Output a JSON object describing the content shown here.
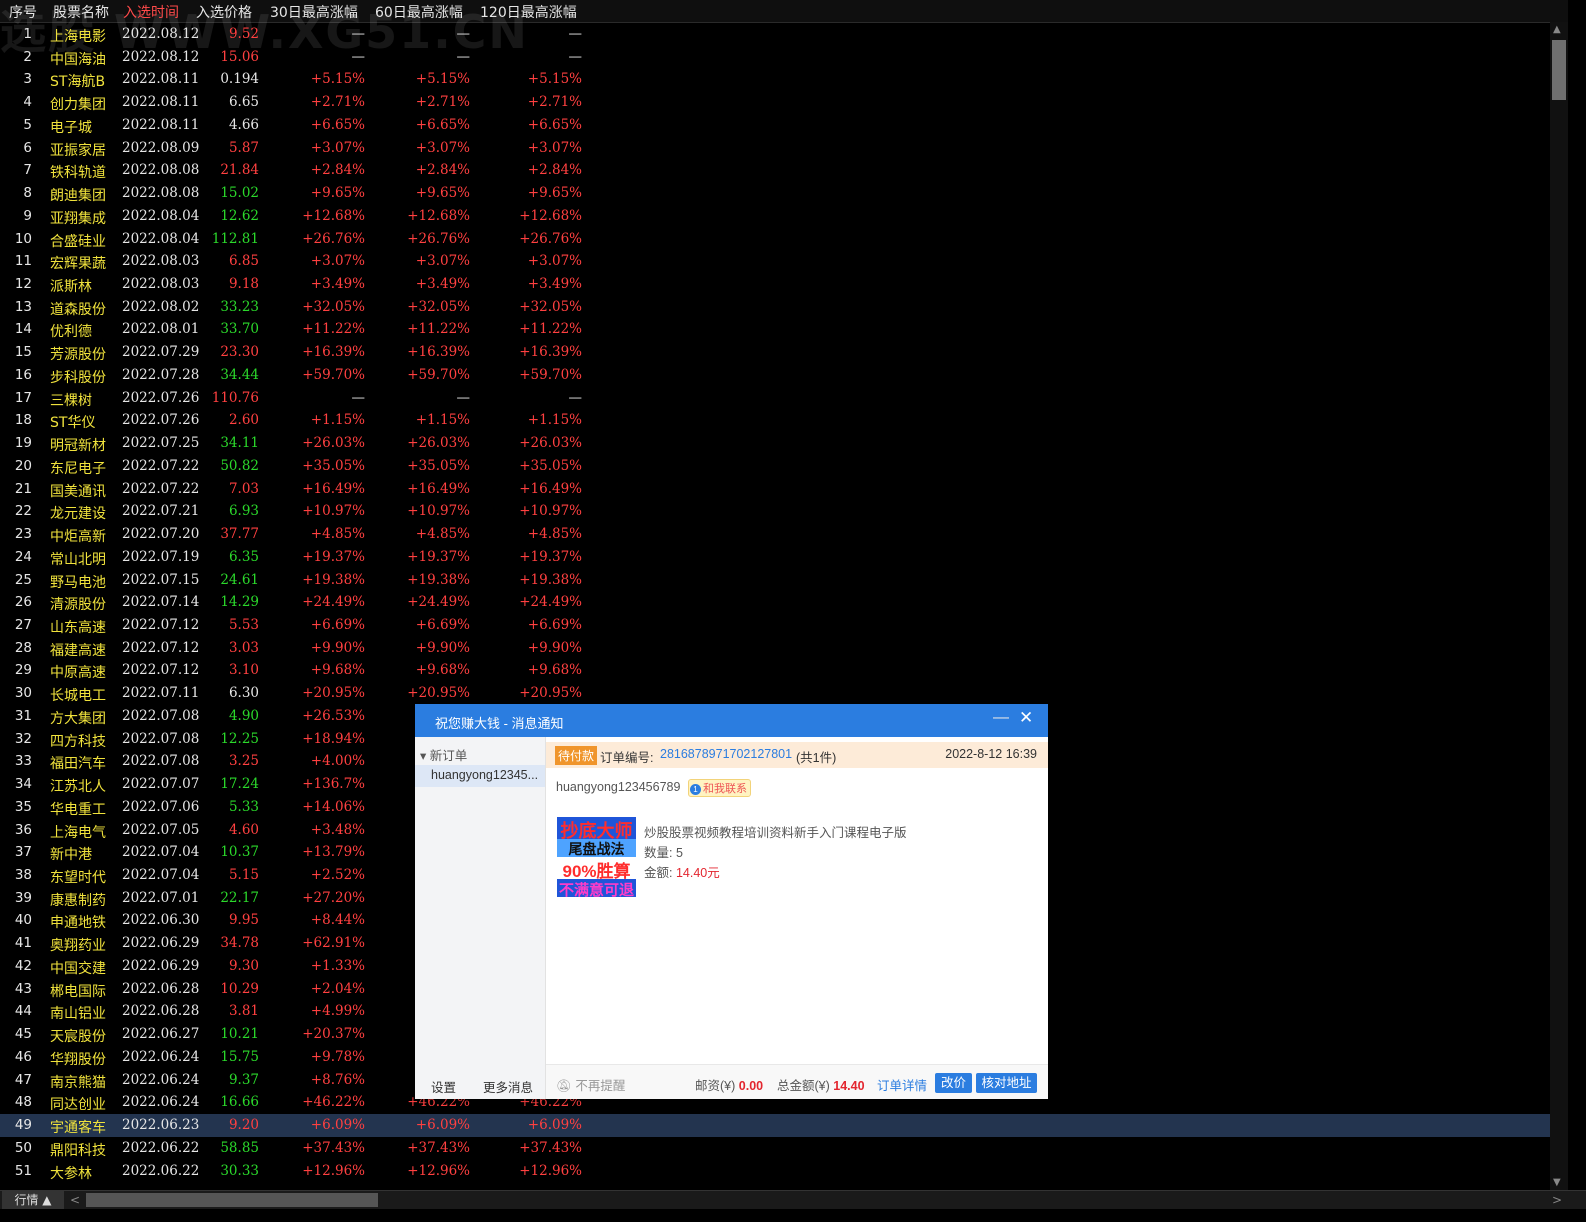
{
  "header": {
    "columns": [
      "序号",
      "股票名称",
      "入选时间",
      "入选价格",
      "30日最高涨幅",
      "60日最高涨幅",
      "120日最高涨幅"
    ],
    "active_column": 2
  },
  "watermark": "选股 WWW.XG51.CN",
  "colors": {
    "red": "#ff4040",
    "green": "#2bd82b",
    "yellow": "#f0e23c",
    "selected_row": "#23344f",
    "accent": "#2b7de0"
  },
  "selected_row": 49,
  "rows": [
    {
      "idx": "1",
      "name": "上海电影",
      "date": "2022.08.12",
      "price": "9.52",
      "pc": "red",
      "g30": "—",
      "g60": "—",
      "g120": "—"
    },
    {
      "idx": "2",
      "name": "中国海油",
      "date": "2022.08.12",
      "price": "15.06",
      "pc": "red",
      "g30": "—",
      "g60": "—",
      "g120": "—"
    },
    {
      "idx": "3",
      "name": "ST海航B",
      "date": "2022.08.11",
      "price": "0.194",
      "pc": "white",
      "g30": "+5.15%",
      "g60": "+5.15%",
      "g120": "+5.15%"
    },
    {
      "idx": "4",
      "name": "创力集团",
      "date": "2022.08.11",
      "price": "6.65",
      "pc": "white",
      "g30": "+2.71%",
      "g60": "+2.71%",
      "g120": "+2.71%"
    },
    {
      "idx": "5",
      "name": "电子城",
      "date": "2022.08.11",
      "price": "4.66",
      "pc": "white",
      "g30": "+6.65%",
      "g60": "+6.65%",
      "g120": "+6.65%"
    },
    {
      "idx": "6",
      "name": "亚振家居",
      "date": "2022.08.09",
      "price": "5.87",
      "pc": "red",
      "g30": "+3.07%",
      "g60": "+3.07%",
      "g120": "+3.07%"
    },
    {
      "idx": "7",
      "name": "铁科轨道",
      "date": "2022.08.08",
      "price": "21.84",
      "pc": "red",
      "g30": "+2.84%",
      "g60": "+2.84%",
      "g120": "+2.84%"
    },
    {
      "idx": "8",
      "name": "朗迪集团",
      "date": "2022.08.08",
      "price": "15.02",
      "pc": "green",
      "g30": "+9.65%",
      "g60": "+9.65%",
      "g120": "+9.65%"
    },
    {
      "idx": "9",
      "name": "亚翔集成",
      "date": "2022.08.04",
      "price": "12.62",
      "pc": "green",
      "g30": "+12.68%",
      "g60": "+12.68%",
      "g120": "+12.68%"
    },
    {
      "idx": "10",
      "name": "合盛硅业",
      "date": "2022.08.04",
      "price": "112.81",
      "pc": "green",
      "g30": "+26.76%",
      "g60": "+26.76%",
      "g120": "+26.76%"
    },
    {
      "idx": "11",
      "name": "宏辉果蔬",
      "date": "2022.08.03",
      "price": "6.85",
      "pc": "red",
      "g30": "+3.07%",
      "g60": "+3.07%",
      "g120": "+3.07%"
    },
    {
      "idx": "12",
      "name": "派斯林",
      "date": "2022.08.03",
      "price": "9.18",
      "pc": "red",
      "g30": "+3.49%",
      "g60": "+3.49%",
      "g120": "+3.49%"
    },
    {
      "idx": "13",
      "name": "道森股份",
      "date": "2022.08.02",
      "price": "33.23",
      "pc": "green",
      "g30": "+32.05%",
      "g60": "+32.05%",
      "g120": "+32.05%"
    },
    {
      "idx": "14",
      "name": "优利德",
      "date": "2022.08.01",
      "price": "33.70",
      "pc": "green",
      "g30": "+11.22%",
      "g60": "+11.22%",
      "g120": "+11.22%"
    },
    {
      "idx": "15",
      "name": "芳源股份",
      "date": "2022.07.29",
      "price": "23.30",
      "pc": "red",
      "g30": "+16.39%",
      "g60": "+16.39%",
      "g120": "+16.39%"
    },
    {
      "idx": "16",
      "name": "步科股份",
      "date": "2022.07.28",
      "price": "34.44",
      "pc": "green",
      "g30": "+59.70%",
      "g60": "+59.70%",
      "g120": "+59.70%"
    },
    {
      "idx": "17",
      "name": "三棵树",
      "date": "2022.07.26",
      "price": "110.76",
      "pc": "red",
      "g30": "—",
      "g60": "—",
      "g120": "—"
    },
    {
      "idx": "18",
      "name": "ST华仪",
      "date": "2022.07.26",
      "price": "2.60",
      "pc": "red",
      "g30": "+1.15%",
      "g60": "+1.15%",
      "g120": "+1.15%"
    },
    {
      "idx": "19",
      "name": "明冠新材",
      "date": "2022.07.25",
      "price": "34.11",
      "pc": "green",
      "g30": "+26.03%",
      "g60": "+26.03%",
      "g120": "+26.03%"
    },
    {
      "idx": "20",
      "name": "东尼电子",
      "date": "2022.07.22",
      "price": "50.82",
      "pc": "green",
      "g30": "+35.05%",
      "g60": "+35.05%",
      "g120": "+35.05%"
    },
    {
      "idx": "21",
      "name": "国美通讯",
      "date": "2022.07.22",
      "price": "7.03",
      "pc": "red",
      "g30": "+16.49%",
      "g60": "+16.49%",
      "g120": "+16.49%"
    },
    {
      "idx": "22",
      "name": "龙元建设",
      "date": "2022.07.21",
      "price": "6.93",
      "pc": "green",
      "g30": "+10.97%",
      "g60": "+10.97%",
      "g120": "+10.97%"
    },
    {
      "idx": "23",
      "name": "中炬高新",
      "date": "2022.07.20",
      "price": "37.77",
      "pc": "red",
      "g30": "+4.85%",
      "g60": "+4.85%",
      "g120": "+4.85%"
    },
    {
      "idx": "24",
      "name": "常山北明",
      "date": "2022.07.19",
      "price": "6.35",
      "pc": "green",
      "g30": "+19.37%",
      "g60": "+19.37%",
      "g120": "+19.37%"
    },
    {
      "idx": "25",
      "name": "野马电池",
      "date": "2022.07.15",
      "price": "24.61",
      "pc": "green",
      "g30": "+19.38%",
      "g60": "+19.38%",
      "g120": "+19.38%"
    },
    {
      "idx": "26",
      "name": "清源股份",
      "date": "2022.07.14",
      "price": "14.29",
      "pc": "green",
      "g30": "+24.49%",
      "g60": "+24.49%",
      "g120": "+24.49%"
    },
    {
      "idx": "27",
      "name": "山东高速",
      "date": "2022.07.12",
      "price": "5.53",
      "pc": "red",
      "g30": "+6.69%",
      "g60": "+6.69%",
      "g120": "+6.69%"
    },
    {
      "idx": "28",
      "name": "福建高速",
      "date": "2022.07.12",
      "price": "3.03",
      "pc": "red",
      "g30": "+9.90%",
      "g60": "+9.90%",
      "g120": "+9.90%"
    },
    {
      "idx": "29",
      "name": "中原高速",
      "date": "2022.07.12",
      "price": "3.10",
      "pc": "red",
      "g30": "+9.68%",
      "g60": "+9.68%",
      "g120": "+9.68%"
    },
    {
      "idx": "30",
      "name": "长城电工",
      "date": "2022.07.11",
      "price": "6.30",
      "pc": "white",
      "g30": "+20.95%",
      "g60": "+20.95%",
      "g120": "+20.95%"
    },
    {
      "idx": "31",
      "name": "方大集团",
      "date": "2022.07.08",
      "price": "4.90",
      "pc": "green",
      "g30": "+26.53%",
      "g60": "",
      "g120": ""
    },
    {
      "idx": "32",
      "name": "四方科技",
      "date": "2022.07.08",
      "price": "12.25",
      "pc": "green",
      "g30": "+18.94%",
      "g60": "",
      "g120": ""
    },
    {
      "idx": "33",
      "name": "福田汽车",
      "date": "2022.07.08",
      "price": "3.25",
      "pc": "red",
      "g30": "+4.00%",
      "g60": "",
      "g120": ""
    },
    {
      "idx": "34",
      "name": "江苏北人",
      "date": "2022.07.07",
      "price": "17.24",
      "pc": "green",
      "g30": "+136.7%",
      "g60": "",
      "g120": ""
    },
    {
      "idx": "35",
      "name": "华电重工",
      "date": "2022.07.06",
      "price": "5.33",
      "pc": "green",
      "g30": "+14.06%",
      "g60": "",
      "g120": ""
    },
    {
      "idx": "36",
      "name": "上海电气",
      "date": "2022.07.05",
      "price": "4.60",
      "pc": "red",
      "g30": "+3.48%",
      "g60": "",
      "g120": ""
    },
    {
      "idx": "37",
      "name": "新中港",
      "date": "2022.07.04",
      "price": "10.37",
      "pc": "green",
      "g30": "+13.79%",
      "g60": "",
      "g120": ""
    },
    {
      "idx": "38",
      "name": "东望时代",
      "date": "2022.07.04",
      "price": "5.15",
      "pc": "red",
      "g30": "+2.52%",
      "g60": "",
      "g120": ""
    },
    {
      "idx": "39",
      "name": "康惠制药",
      "date": "2022.07.01",
      "price": "22.17",
      "pc": "green",
      "g30": "+27.20%",
      "g60": "",
      "g120": ""
    },
    {
      "idx": "40",
      "name": "申通地铁",
      "date": "2022.06.30",
      "price": "9.95",
      "pc": "red",
      "g30": "+8.44%",
      "g60": "",
      "g120": ""
    },
    {
      "idx": "41",
      "name": "奥翔药业",
      "date": "2022.06.29",
      "price": "34.78",
      "pc": "red",
      "g30": "+62.91%",
      "g60": "",
      "g120": ""
    },
    {
      "idx": "42",
      "name": "中国交建",
      "date": "2022.06.29",
      "price": "9.30",
      "pc": "red",
      "g30": "+1.33%",
      "g60": "",
      "g120": ""
    },
    {
      "idx": "43",
      "name": "郴电国际",
      "date": "2022.06.28",
      "price": "10.29",
      "pc": "red",
      "g30": "+2.04%",
      "g60": "",
      "g120": ""
    },
    {
      "idx": "44",
      "name": "南山铝业",
      "date": "2022.06.28",
      "price": "3.81",
      "pc": "red",
      "g30": "+4.99%",
      "g60": "",
      "g120": ""
    },
    {
      "idx": "45",
      "name": "天宸股份",
      "date": "2022.06.27",
      "price": "10.21",
      "pc": "green",
      "g30": "+20.37%",
      "g60": "",
      "g120": ""
    },
    {
      "idx": "46",
      "name": "华翔股份",
      "date": "2022.06.24",
      "price": "15.75",
      "pc": "green",
      "g30": "+9.78%",
      "g60": "",
      "g120": ""
    },
    {
      "idx": "47",
      "name": "南京熊猫",
      "date": "2022.06.24",
      "price": "9.37",
      "pc": "green",
      "g30": "+8.76%",
      "g60": "",
      "g120": ""
    },
    {
      "idx": "48",
      "name": "同达创业",
      "date": "2022.06.24",
      "price": "16.66",
      "pc": "green",
      "g30": "+46.22%",
      "g60": "+46.22%",
      "g120": "+46.22%"
    },
    {
      "idx": "49",
      "name": "宇通客车",
      "date": "2022.06.23",
      "price": "9.20",
      "pc": "red",
      "g30": "+6.09%",
      "g60": "+6.09%",
      "g120": "+6.09%"
    },
    {
      "idx": "50",
      "name": "鼎阳科技",
      "date": "2022.06.22",
      "price": "58.85",
      "pc": "green",
      "g30": "+37.43%",
      "g60": "+37.43%",
      "g120": "+37.43%"
    },
    {
      "idx": "51",
      "name": "大参林",
      "date": "2022.06.22",
      "price": "30.33",
      "pc": "green",
      "g30": "+12.96%",
      "g60": "+12.96%",
      "g120": "+12.96%"
    }
  ],
  "bottom": {
    "tab_label": "行情 ▲",
    "left_arrow": "<",
    "right_arrow": ">"
  },
  "scroll": {
    "up": "▲",
    "down": "▼"
  },
  "popup": {
    "title": "祝您赚大钱 - 消息通知",
    "minimize": "—",
    "close": "✕",
    "sidebar": {
      "group": "▾ 新订单",
      "item": "huangyong12345...",
      "settings": "设置",
      "more": "更多消息"
    },
    "order": {
      "status_tag": "待付款",
      "number_label": "订单编号:",
      "number": "2816878971702127801",
      "count": "(共1件)",
      "time": "2022-8-12 16:39"
    },
    "buyer": "huangyong123456789",
    "chat_badge": "和我联系",
    "chat_badge_icon": "1",
    "product": {
      "image_lines": [
        "抄底大师",
        "尾盘战法",
        "90%胜算",
        "不满意可退"
      ],
      "title": "炒股股票视频教程培训资料新手入门课程电子版",
      "qty_label": "数量:",
      "qty": "5",
      "amount_label": "金额:",
      "amount": "14.40元"
    },
    "footer": {
      "no_remind": "不再提醒",
      "postage_label": "邮资(¥)",
      "postage": "0.00",
      "total_label": "总金额(¥)",
      "total": "14.40",
      "detail": "订单详情",
      "btn_price": "改价",
      "btn_address": "核对地址"
    }
  }
}
